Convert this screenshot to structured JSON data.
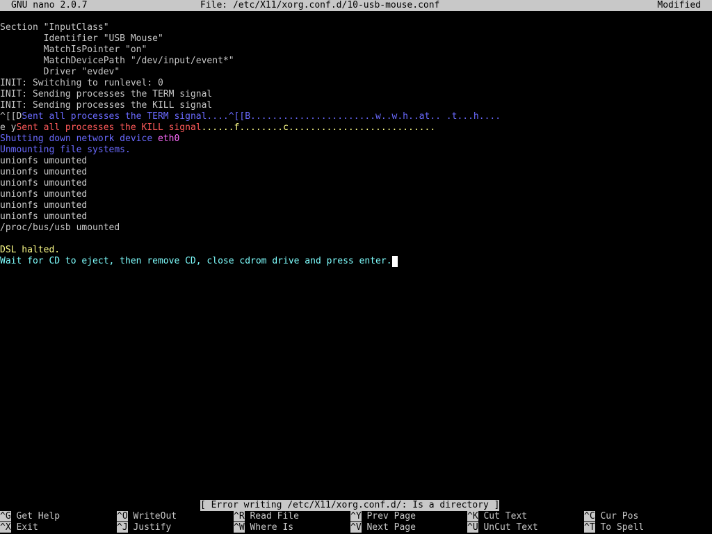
{
  "titlebar": {
    "app_version": "GNU nano 2.0.7",
    "file": "File: /etc/X11/xorg.conf.d/10-usb-mouse.conf",
    "state": "Modified"
  },
  "editor": {
    "lines": [
      "Section \"InputClass\"",
      "        Identifier \"USB Mouse\"",
      "        MatchIsPointer \"on\"",
      "        MatchDevicePath \"/dev/input/event*\"",
      "        Driver \"evdev\"",
      "INIT: Switching to runlevel: 0",
      "INIT: Sending processes the TERM signal",
      "INIT: Sending processes the KILL signal"
    ],
    "term_line": {
      "prefix": "^[[D",
      "message": "Sent all processes the TERM signal",
      "suffix": "....^[[B.......................w..w.h..at.. .t...h...."
    },
    "kill_line": {
      "prefix": "e y",
      "message": "Sent all processes the KILL signal",
      "suffix": "......f........c..........................."
    },
    "network_line": {
      "message": "Shutting down network device ",
      "device": "eth0"
    },
    "unmount_line": "Unmounting file systems.",
    "unmounted": [
      "unionfs umounted",
      "unionfs umounted",
      "unionfs umounted",
      "unionfs umounted",
      "unionfs umounted",
      "unionfs umounted",
      "/proc/bus/usb umounted"
    ],
    "halted": "DSL halted.",
    "eject_prompt": "Wait for CD to eject, then remove CD, close cdrom drive and press enter."
  },
  "status_message": "[ Error writing /etc/X11/xorg.conf.d/: Is a directory ]",
  "shortcuts": [
    {
      "key": "^G",
      "label": "Get Help"
    },
    {
      "key": "^O",
      "label": "WriteOut"
    },
    {
      "key": "^R",
      "label": "Read File"
    },
    {
      "key": "^Y",
      "label": "Prev Page"
    },
    {
      "key": "^K",
      "label": "Cut Text"
    },
    {
      "key": "^C",
      "label": "Cur Pos"
    },
    {
      "key": "^X",
      "label": "Exit"
    },
    {
      "key": "^J",
      "label": "Justify"
    },
    {
      "key": "^W",
      "label": "Where Is"
    },
    {
      "key": "^V",
      "label": "Next Page"
    },
    {
      "key": "^U",
      "label": "UnCut Text"
    },
    {
      "key": "^T",
      "label": "To Spell"
    }
  ],
  "colors": {
    "background": "#000000",
    "text": "#c8c8c8",
    "highlight_bar": "#c8c8c8",
    "blue_message": "#6a6aff",
    "red_message": "#ff5a5a",
    "magenta_device": "#ff6cff",
    "yellow_message": "#ffff8a",
    "cyan_message": "#7fffff"
  }
}
